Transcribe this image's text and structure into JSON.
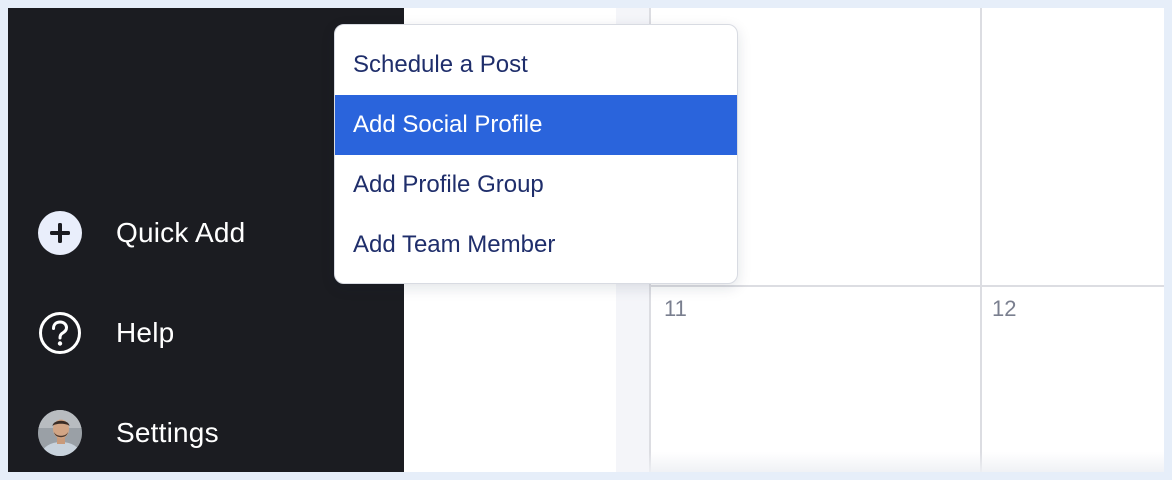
{
  "sidebar": {
    "items": [
      {
        "label": "Quick Add",
        "icon": "plus-circle-icon"
      },
      {
        "label": "Help",
        "icon": "question-circle-icon"
      },
      {
        "label": "Settings",
        "icon": "avatar"
      }
    ]
  },
  "quick_add_menu": {
    "items": [
      {
        "label": "Schedule a Post",
        "active": false
      },
      {
        "label": "Add Social Profile",
        "active": true
      },
      {
        "label": "Add Profile Group",
        "active": false
      },
      {
        "label": "Add Team Member",
        "active": false
      }
    ],
    "active_color": "#2a64dc"
  },
  "calendar": {
    "days": [
      "11",
      "12"
    ]
  },
  "colors": {
    "sidebar_bg": "#1b1c21",
    "menu_text": "#1f2e6b",
    "accent": "#2a64dc"
  }
}
